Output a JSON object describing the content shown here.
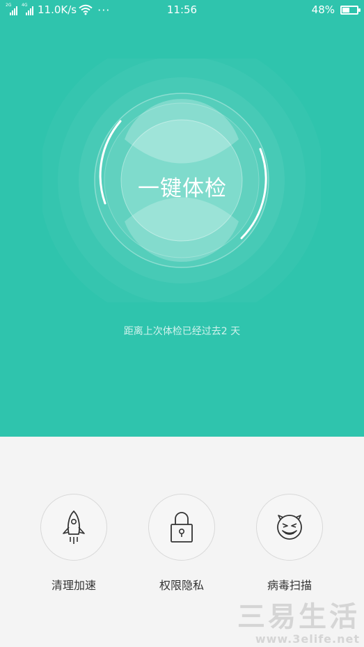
{
  "status_bar": {
    "network_left": "2G",
    "network_right": "4G",
    "speed": "11.0K/s",
    "time": "11:56",
    "battery": "48%",
    "battery_level": 0.48,
    "more": "···"
  },
  "main": {
    "check_button_label": "一键体检",
    "last_check_text": "距离上次体检已经过去2 天"
  },
  "tools": [
    {
      "label": "清理加速",
      "icon": "rocket-icon"
    },
    {
      "label": "权限隐私",
      "icon": "lock-icon"
    },
    {
      "label": "病毒扫描",
      "icon": "virus-face-icon"
    }
  ],
  "watermark": {
    "brand": "三易生活",
    "url": "www.3elife.net"
  },
  "colors": {
    "primary": "#2fc4ad",
    "background": "#f4f4f4",
    "text": "#333333"
  }
}
